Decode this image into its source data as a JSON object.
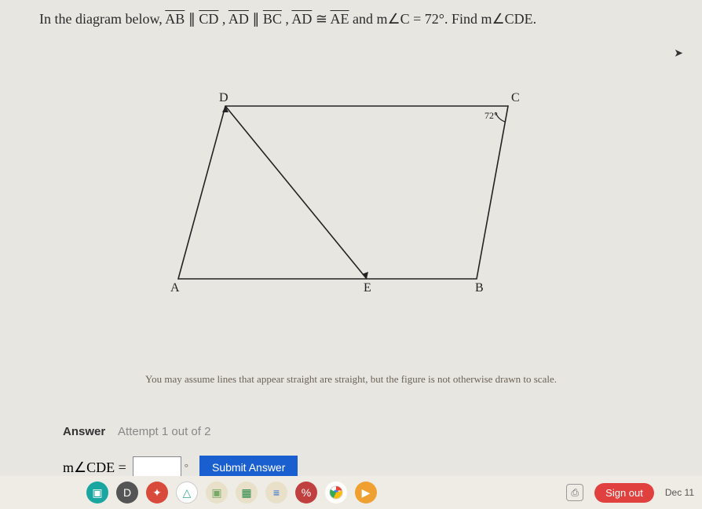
{
  "problem": {
    "intro": "In the diagram below, ",
    "seg1": "AB",
    "par1": " ∥ ",
    "seg2": "CD",
    "comma1": ", ",
    "seg3": "AD",
    "par2": " ∥ ",
    "seg4": "BC",
    "comma2": ", ",
    "seg5": "AD",
    "cong": " ≅ ",
    "seg6": "AE",
    "and": " and m∠C = 72°. Find m∠CDE."
  },
  "diagram": {
    "labelD": "D",
    "labelC": "C",
    "labelA": "A",
    "labelE": "E",
    "labelB": "B",
    "angleC": "72°"
  },
  "caption": "You may assume lines that appear straight are straight, but the figure is not otherwise drawn to scale.",
  "answer": {
    "label": "Answer",
    "attempt": "Attempt 1 out of 2",
    "prefix": "m∠CDE =",
    "value": "",
    "degree": "°",
    "submit": "Submit Answer"
  },
  "taskbar": {
    "signout": "Sign out",
    "date": "Dec 11"
  }
}
